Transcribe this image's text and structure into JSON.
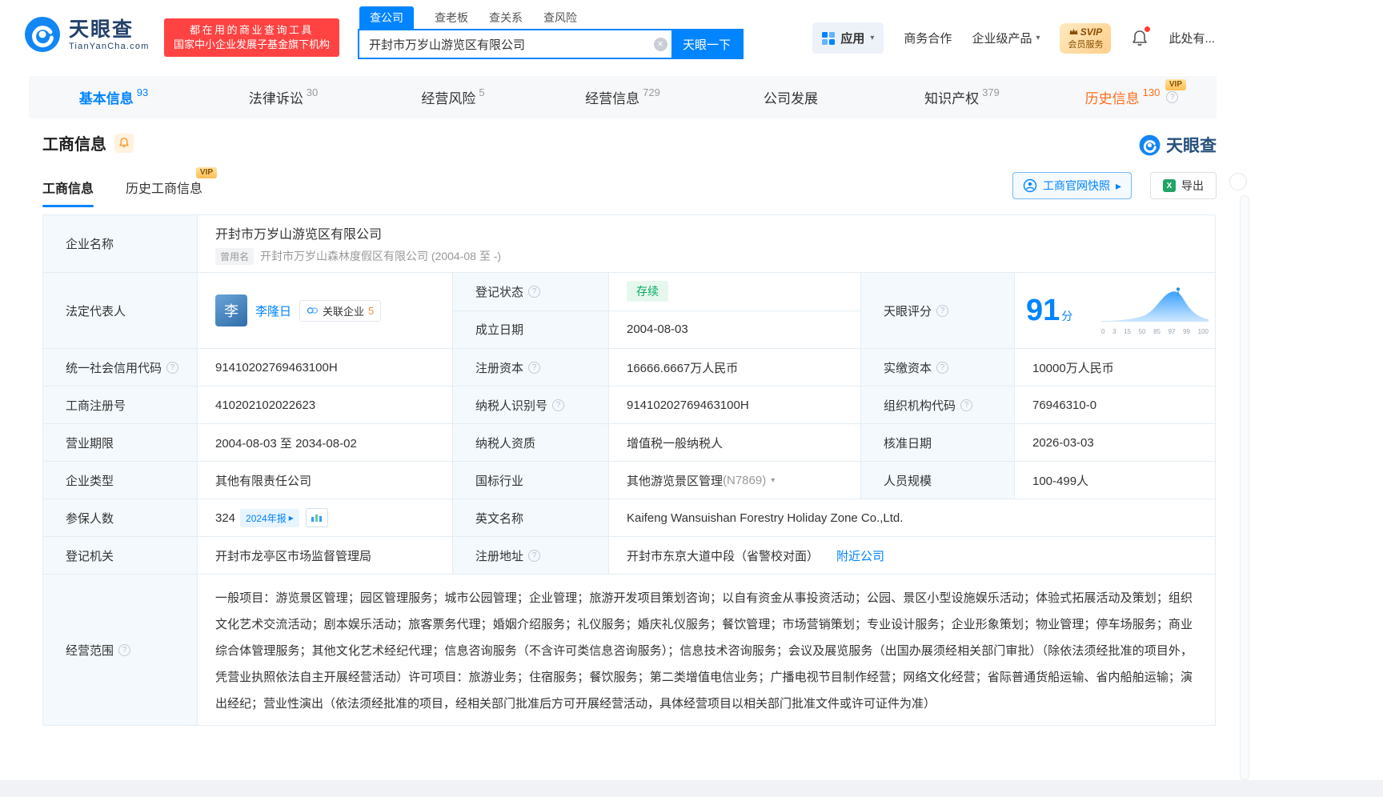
{
  "colors": {
    "primary": "#0084ff",
    "promo_red": "#ff4343",
    "status_green": "#00a95f",
    "history_orange": "#ff6c1a",
    "vip_gold": "#ffbd55"
  },
  "icons": {
    "clear": "×",
    "caret": "▾",
    "arrow_right": "▸",
    "chevron_down": "▾",
    "help": "?",
    "excel": "X"
  },
  "badges": {
    "vip": "VIP"
  },
  "header": {
    "logo": {
      "name": "天眼查",
      "domain": "TianYanCha.com"
    },
    "promo": {
      "line1": "都在用的商业查询工具",
      "line2": "国家中小企业发展子基金旗下机构"
    },
    "search": {
      "tabs": [
        {
          "label": "查公司"
        },
        {
          "label": "查老板"
        },
        {
          "label": "查关系"
        },
        {
          "label": "查风险"
        }
      ],
      "value": "开封市万岁山游览区有限公司",
      "button": "天眼一下"
    },
    "right": {
      "apps": "应用",
      "biz": "商务合作",
      "enterprise": "企业级产品",
      "svip_top": "SVIP",
      "svip_bottom": "会员服务",
      "user": "此处有..."
    }
  },
  "nav_tabs": [
    {
      "label": "基本信息",
      "count": "93"
    },
    {
      "label": "法律诉讼",
      "count": "30"
    },
    {
      "label": "经营风险",
      "count": "5"
    },
    {
      "label": "经营信息",
      "count": "729"
    },
    {
      "label": "公司发展",
      "count": ""
    },
    {
      "label": "知识产权",
      "count": "379"
    },
    {
      "label": "历史信息",
      "count": "130"
    }
  ],
  "section": {
    "title": "工商信息",
    "brand": "天眼查",
    "subtab_current": "工商信息",
    "subtab_history": "历史工商信息",
    "snapshot": "工商官网快照",
    "export": "导出"
  },
  "table": {
    "company_name": {
      "label": "企业名称",
      "value": "开封市万岁山游览区有限公司",
      "former_tag": "曾用名",
      "former": "开封市万岁山森林度假区有限公司 (2004-08 至 -)"
    },
    "legal_rep": {
      "label": "法定代表人",
      "avatar": "李",
      "name": "李隆日",
      "related_label": "关联企业",
      "related_count": "5"
    },
    "reg_status": {
      "label": "登记状态",
      "value": "存续"
    },
    "establish_date": {
      "label": "成立日期",
      "value": "2004-08-03"
    },
    "score": {
      "label": "天眼评分",
      "value": "91",
      "unit": "分",
      "axis": [
        "0",
        "3",
        "15",
        "50",
        "85",
        "97",
        "99",
        "100"
      ]
    },
    "credit_code": {
      "label": "统一社会信用代码",
      "value": "91410202769463100H"
    },
    "reg_capital": {
      "label": "注册资本",
      "value": "16666.6667万人民币"
    },
    "paid_capital": {
      "label": "实缴资本",
      "value": "10000万人民币"
    },
    "reg_no": {
      "label": "工商注册号",
      "value": "410202102022623"
    },
    "taxpayer_no": {
      "label": "纳税人识别号",
      "value": "91410202769463100H"
    },
    "org_code": {
      "label": "组织机构代码",
      "value": "76946310-0"
    },
    "term": {
      "label": "营业期限",
      "value": "2004-08-03 至 2034-08-02"
    },
    "taxpayer_quality": {
      "label": "纳税人资质",
      "value": "增值税一般纳税人"
    },
    "approve_date": {
      "label": "核准日期",
      "value": "2026-03-03"
    },
    "company_type": {
      "label": "企业类型",
      "value": "其他有限责任公司"
    },
    "industry": {
      "label": "国标行业",
      "value": "其他游览景区管理",
      "code": "(N7869)"
    },
    "staff": {
      "label": "人员规模",
      "value": "100-499人"
    },
    "insured": {
      "label": "参保人数",
      "value": "324",
      "report": "2024年报"
    },
    "english_name": {
      "label": "英文名称",
      "value": "Kaifeng Wansuishan Forestry Holiday Zone Co.,Ltd."
    },
    "authority": {
      "label": "登记机关",
      "value": "开封市龙亭区市场监督管理局"
    },
    "address": {
      "label": "注册地址",
      "value": "开封市东京大道中段（省警校对面）",
      "nearby": "附近公司"
    },
    "scope": {
      "label": "经营范围",
      "value": "一般项目：游览景区管理；园区管理服务；城市公园管理；企业管理；旅游开发项目策划咨询；以自有资金从事投资活动；公园、景区小型设施娱乐活动；体验式拓展活动及策划；组织文化艺术交流活动；剧本娱乐活动；旅客票务代理；婚姻介绍服务；礼仪服务；婚庆礼仪服务；餐饮管理；市场营销策划；专业设计服务；企业形象策划；物业管理；停车场服务；商业综合体管理服务；其他文化艺术经纪代理；信息咨询服务（不含许可类信息咨询服务）；信息技术咨询服务；会议及展览服务（出国办展须经相关部门审批）（除依法须经批准的项目外，凭营业执照依法自主开展经营活动）许可项目：旅游业务；住宿服务；餐饮服务；第二类增值电信业务；广播电视节目制作经营；网络文化经营；省际普通货船运输、省内船舶运输；演出经纪；营业性演出（依法须经批准的项目，经相关部门批准后方可开展经营活动，具体经营项目以相关部门批准文件或许可证件为准）"
    }
  }
}
